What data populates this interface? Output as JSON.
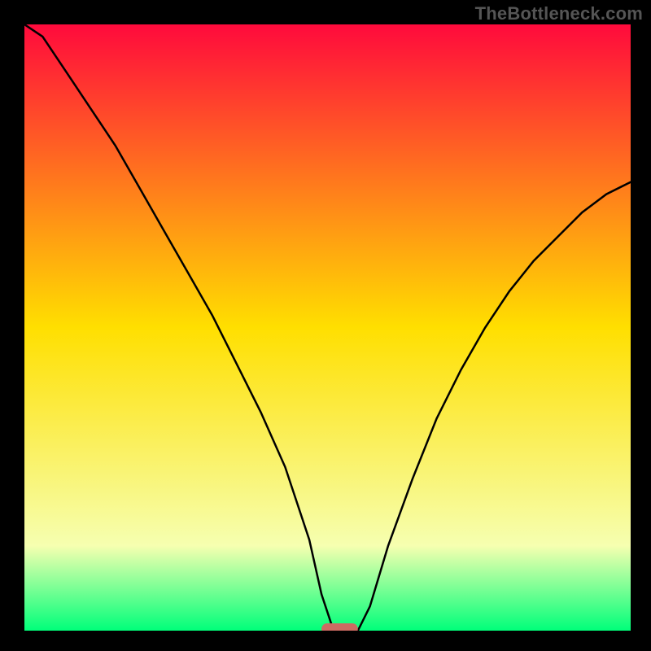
{
  "watermark": "TheBottleneck.com",
  "colors": {
    "frame": "#000000",
    "watermark": "#555555",
    "gradient_top": "#ff0a3c",
    "gradient_mid": "#ffdf00",
    "gradient_low": "#f6ffb0",
    "gradient_bottom": "#00ff7a",
    "curve": "#000000",
    "marker": "#cc6b62"
  },
  "chart_data": {
    "type": "line",
    "title": "",
    "xlabel": "",
    "ylabel": "",
    "xlim": [
      0,
      100
    ],
    "ylim": [
      0,
      100
    ],
    "x": [
      0,
      3,
      7,
      11,
      15,
      19,
      23,
      27,
      31,
      35,
      39,
      43,
      47,
      49,
      51,
      53,
      55,
      57,
      60,
      64,
      68,
      72,
      76,
      80,
      84,
      88,
      92,
      96,
      100
    ],
    "values": [
      100,
      98,
      92,
      86,
      80,
      73,
      66,
      59,
      52,
      44,
      36,
      27,
      15,
      6,
      0,
      0,
      0,
      4,
      14,
      25,
      35,
      43,
      50,
      56,
      61,
      65,
      69,
      72,
      74
    ],
    "marker": {
      "x_start": 49,
      "x_end": 55,
      "y": 0
    },
    "background_gradient": {
      "stops": [
        {
          "offset": 0.0,
          "color": "#ff0a3c"
        },
        {
          "offset": 0.5,
          "color": "#ffdf00"
        },
        {
          "offset": 0.86,
          "color": "#f6ffb0"
        },
        {
          "offset": 1.0,
          "color": "#00ff7a"
        }
      ]
    }
  }
}
